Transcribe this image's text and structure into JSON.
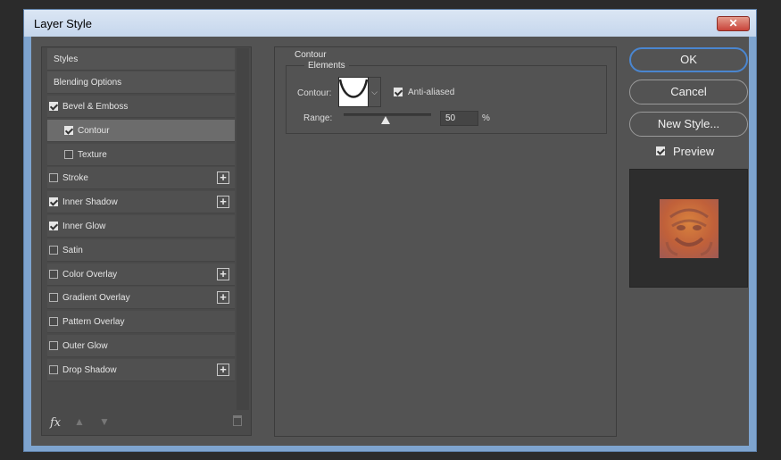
{
  "window": {
    "title": "Layer Style",
    "close_label": "✕"
  },
  "styles_list": {
    "header_styles": "Styles",
    "header_blending": "Blending Options",
    "items": [
      {
        "label": "Bevel & Emboss",
        "checked": true,
        "has_add": false
      },
      {
        "label": "Contour",
        "checked": true,
        "has_add": false,
        "selected": true
      },
      {
        "label": "Texture",
        "checked": false,
        "has_add": false
      },
      {
        "label": "Stroke",
        "checked": false,
        "has_add": true
      },
      {
        "label": "Inner Shadow",
        "checked": true,
        "has_add": true
      },
      {
        "label": "Inner Glow",
        "checked": true,
        "has_add": false
      },
      {
        "label": "Satin",
        "checked": false,
        "has_add": false
      },
      {
        "label": "Color Overlay",
        "checked": false,
        "has_add": true
      },
      {
        "label": "Gradient Overlay",
        "checked": false,
        "has_add": true
      },
      {
        "label": "Pattern Overlay",
        "checked": false,
        "has_add": false
      },
      {
        "label": "Outer Glow",
        "checked": false,
        "has_add": false
      },
      {
        "label": "Drop Shadow",
        "checked": false,
        "has_add": true
      }
    ],
    "fx_label": "fx",
    "add_label": "+"
  },
  "settings": {
    "group_title": "Contour",
    "subgroup_title": "Elements",
    "contour_label": "Contour:",
    "anti_aliased_label": "Anti-aliased",
    "anti_aliased_checked": true,
    "range_label": "Range:",
    "range_value": "50",
    "range_unit": "%",
    "dropdown_icon": "chevron-down-icon"
  },
  "buttons": {
    "ok": "OK",
    "cancel": "Cancel",
    "new_style": "New Style..."
  },
  "preview": {
    "label": "Preview",
    "checked": true
  },
  "colors": {
    "accent": "#4a86d0",
    "dialog_bg": "#535353",
    "panel_bg": "#4a4a4a",
    "selected_row": "#6c6c6c"
  }
}
